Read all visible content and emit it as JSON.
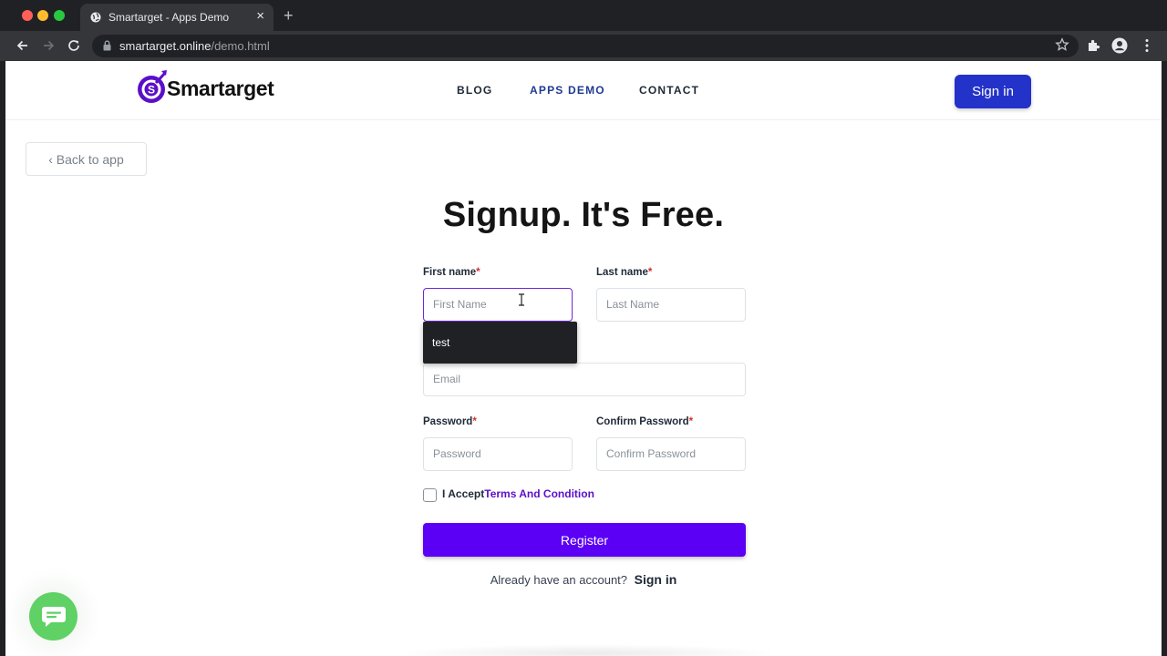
{
  "browser": {
    "tab_title": "Smartarget - Apps Demo",
    "url_host": "smartarget.online",
    "url_path": "/demo.html"
  },
  "header": {
    "logo_text": "Smartarget",
    "nav": [
      "BLOG",
      "APPS DEMO",
      "CONTACT"
    ],
    "signin_label": "Sign in"
  },
  "back_label": "‹ Back to app",
  "title": "Signup. It's Free.",
  "form": {
    "first_name_label": "First name",
    "first_name_placeholder": "First Name",
    "last_name_label": "Last name",
    "last_name_placeholder": "Last Name",
    "email_placeholder": "Email",
    "password_label": "Password",
    "password_placeholder": "Password",
    "confirm_label": "Confirm Password",
    "confirm_placeholder": "Confirm Password",
    "required_mark": "*",
    "accept_text": "I Accept",
    "terms_text": "Terms And Condition",
    "register_label": "Register",
    "already_text": "Already have an account?",
    "signin_link": "Sign in"
  },
  "autocomplete": {
    "suggestion": "test"
  },
  "colors": {
    "accent": "#5b00f5",
    "signin_blue": "#2332c8",
    "chat_green": "#5fd165"
  },
  "icons": {
    "chat_widget": "chat-bubble-icon",
    "favicon": "globe-icon"
  }
}
